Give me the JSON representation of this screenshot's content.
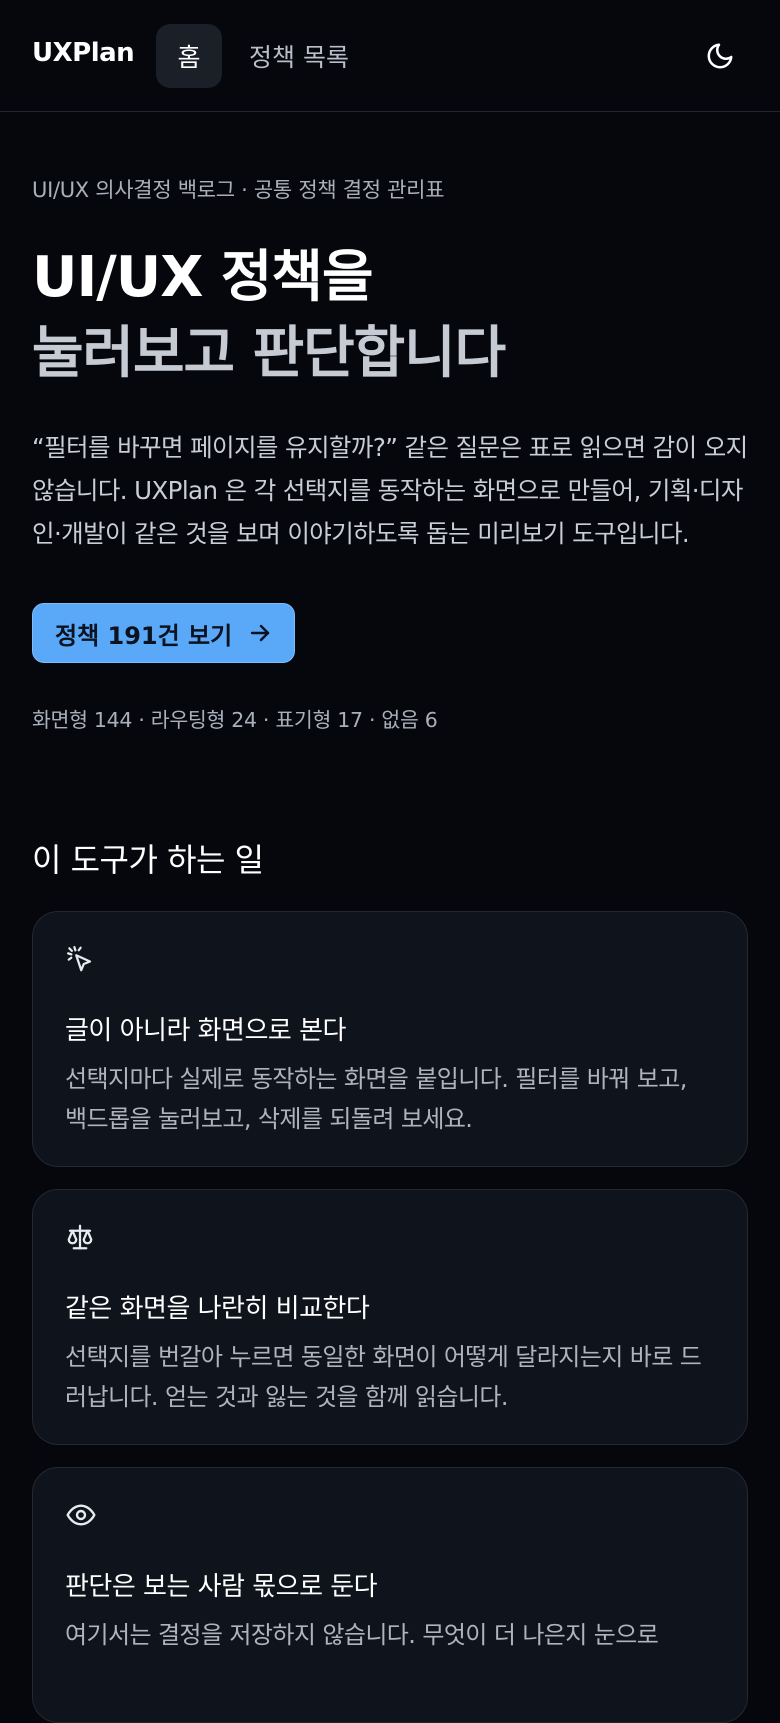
{
  "header": {
    "logo": "UXPlan",
    "nav": {
      "home": "홈",
      "policies": "정책 목록"
    },
    "theme_icon": "moon-icon"
  },
  "hero": {
    "eyebrow": "UI/UX 의사결정 백로그 · 공통 정책 결정 관리표",
    "title_line1": "UI/UX 정책을",
    "title_line2": "눌러보고 판단합니다",
    "lead": "“필터를 바꾸면 페이지를 유지할까?” 같은 질문은 표로 읽으면 감이 오지 않습니다. UXPlan 은 각 선택지를 동작하는 화면으로 만들어, 기획·디자인·개발이 같은 것을 보며 이야기하도록 돕는 미리보기 도구입니다.",
    "cta_label": "정책 191건 보기",
    "cta_icon": "arrow-right-icon",
    "stats": "화면형 144 · 라우팅형 24 · 표기형 17 · 없음 6"
  },
  "features": {
    "title": "이 도구가 하는 일",
    "cards": [
      {
        "icon": "cursor-click-icon",
        "title": "글이 아니라 화면으로 본다",
        "desc": "선택지마다 실제로 동작하는 화면을 붙입니다. 필터를 바꿔 보고, 백드롭을 눌러보고, 삭제를 되돌려 보세요."
      },
      {
        "icon": "scale-icon",
        "title": "같은 화면을 나란히 비교한다",
        "desc": "선택지를 번갈아 누르면 동일한 화면이 어떻게 달라지는지 바로 드러납니다. 얻는 것과 잃는 것을 함께 읽습니다."
      },
      {
        "icon": "eye-icon",
        "title": "판단은 보는 사람 몫으로 둔다",
        "desc": "여기서는 결정을 저장하지 않습니다. 무엇이 더 나은지 눈으로"
      }
    ]
  },
  "colors": {
    "background": "#05070d",
    "accent": "#5aa8f8",
    "card": "#0f131b"
  }
}
